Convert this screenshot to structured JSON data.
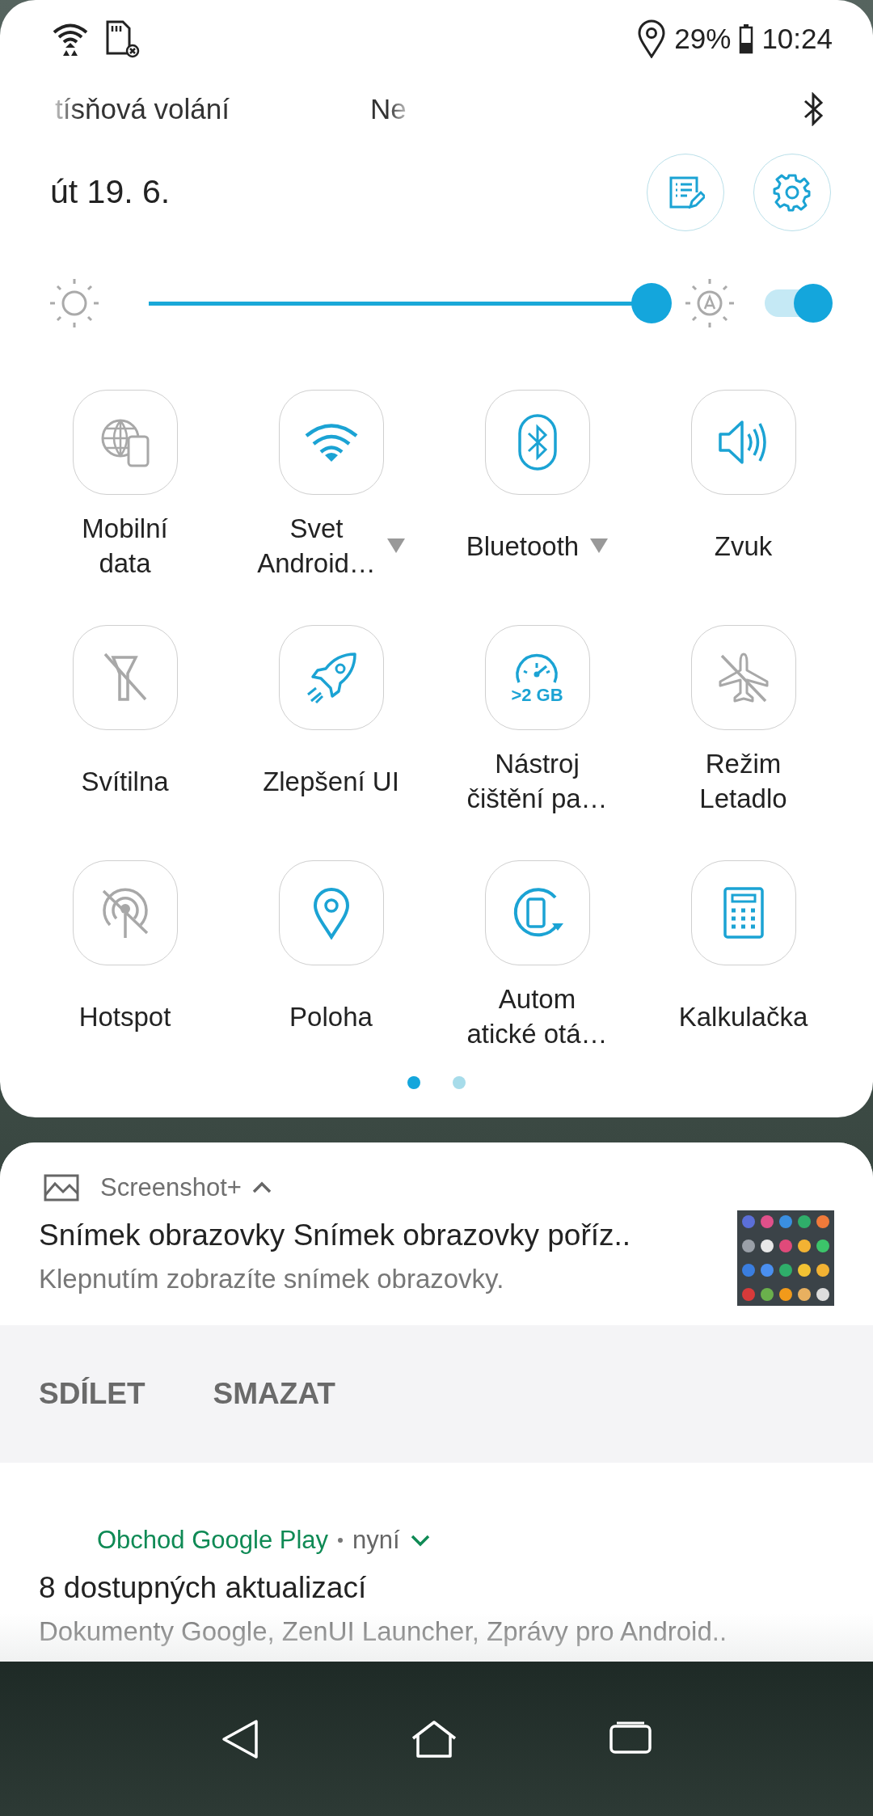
{
  "status_bar": {
    "battery": "29%",
    "time": "10:24"
  },
  "carrier": {
    "left": "tísňová volání",
    "right": "Ne"
  },
  "date": "út 19. 6.",
  "brightness": {
    "level": 1.0,
    "auto": true
  },
  "tiles": [
    {
      "kind": "plain",
      "label": [
        "Mobilní",
        "data"
      ],
      "on": false
    },
    {
      "kind": "dropdown",
      "label": [
        "Svet",
        "Android…"
      ],
      "on": true
    },
    {
      "kind": "dropdown",
      "label": [
        "Bluetooth"
      ],
      "on": true
    },
    {
      "kind": "plain",
      "label": [
        "Zvuk"
      ],
      "on": true
    },
    {
      "kind": "plain",
      "label": [
        "Svítilna"
      ],
      "on": false
    },
    {
      "kind": "plain",
      "label": [
        "Zlepšení UI"
      ],
      "on": true
    },
    {
      "kind": "plain",
      "label": [
        "Nástroj",
        "čištění pa…"
      ],
      "on": true,
      "badge": ">2 GB"
    },
    {
      "kind": "plain",
      "label": [
        "Režim",
        "Letadlo"
      ],
      "on": false
    },
    {
      "kind": "plain",
      "label": [
        "Hotspot"
      ],
      "on": false
    },
    {
      "kind": "plain",
      "label": [
        "Poloha"
      ],
      "on": true
    },
    {
      "kind": "plain",
      "label": [
        "Autom",
        "atické otá…"
      ],
      "on": true
    },
    {
      "kind": "plain",
      "label": [
        "Kalkulačka"
      ],
      "on": true
    }
  ],
  "pages": [
    {
      "selected": true
    },
    {
      "selected": false
    }
  ],
  "notifications": [
    {
      "app": "Screenshot+",
      "color": "#6f6f6f",
      "expanded": true,
      "title": "Snímek obrazovky Snímek obrazovky poříz..",
      "text": "Klepnutím zobrazíte snímek obrazovky.",
      "actions": [
        "SDÍLET",
        "SMAZAT"
      ]
    },
    {
      "app": "Obchod Google Play",
      "color": "#0f8a55",
      "time": "nyní",
      "expanded": false,
      "title": "8 dostupných aktualizací",
      "text": "Dokumenty Google, ZenUI Launcher, Zprávy pro Android.."
    }
  ]
}
